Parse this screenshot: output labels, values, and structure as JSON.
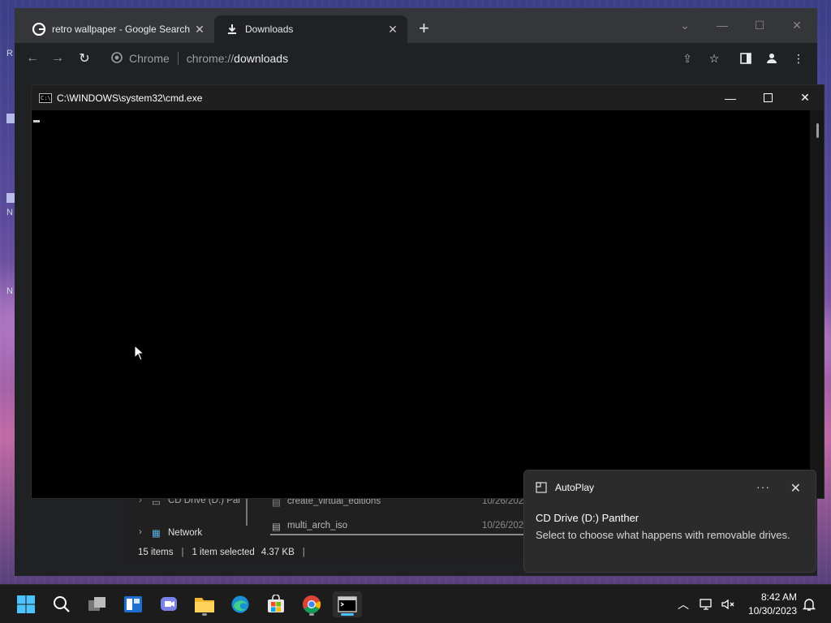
{
  "browser": {
    "tabs": [
      {
        "title": "retro wallpaper - Google Search",
        "icon": "google-icon"
      },
      {
        "title": "Downloads",
        "icon": "download-icon"
      }
    ],
    "new_tab_label": "+",
    "omnibox": {
      "site_label": "Chrome",
      "scheme": "chrome://",
      "path": "downloads"
    }
  },
  "explorer": {
    "nav_items": [
      "CD Drive (D:) Par",
      "Network"
    ],
    "files": [
      {
        "name": "create_virtual_editions",
        "date": "10/26/202"
      },
      {
        "name": "multi_arch_iso",
        "date": "10/26/202"
      }
    ],
    "status": {
      "count": "15 items",
      "selected": "1 item selected",
      "size": "4.37 KB"
    }
  },
  "cmd": {
    "title": "C:\\WINDOWS\\system32\\cmd.exe",
    "icon_text": "C:\\"
  },
  "toast": {
    "app": "AutoPlay",
    "more": "···",
    "title": "CD Drive (D:) Panther",
    "body": "Select to choose what happens with removable drives."
  },
  "taskbar": {
    "time": "8:42 AM",
    "date": "10/30/2023",
    "apps": [
      "start-icon",
      "search-icon",
      "task-view-icon",
      "widgets-icon",
      "teams-chat-icon",
      "file-explorer-icon",
      "edge-icon",
      "store-icon",
      "chrome-icon",
      "terminal-icon"
    ]
  },
  "desktop": {
    "icon_fragments": [
      "R",
      "N",
      "N"
    ]
  }
}
